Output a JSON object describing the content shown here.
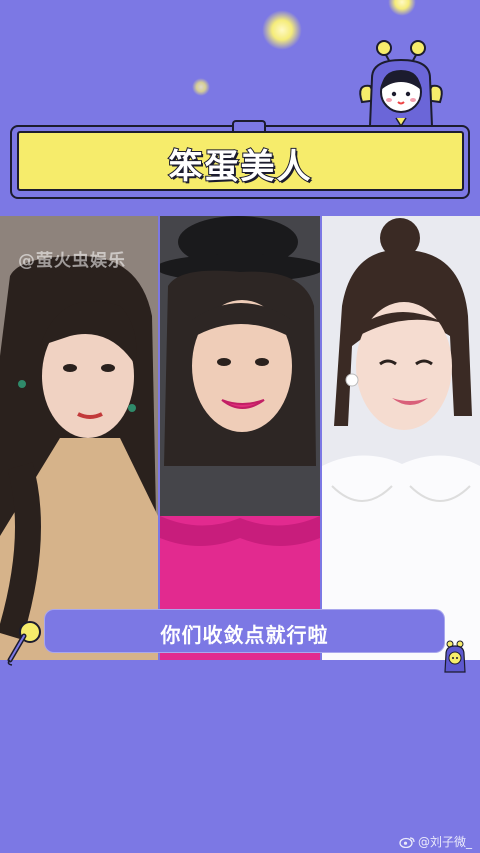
{
  "title": "笨蛋美人",
  "subtitle": "你们收敛点就行啦",
  "watermark_top": "@萤火虫娱乐",
  "watermark_bottom": "@刘子微_",
  "colors": {
    "background": "#7c78e4",
    "title_box": "#f6ec6b",
    "outline": "#1c1c2e",
    "sparkle": "#f5ec7a"
  },
  "icons": {
    "mascot": "bee-mascot-icon",
    "mic": "microphone-icon",
    "mini_mascot": "mini-bee-mascot-icon",
    "weibo": "weibo-icon"
  }
}
